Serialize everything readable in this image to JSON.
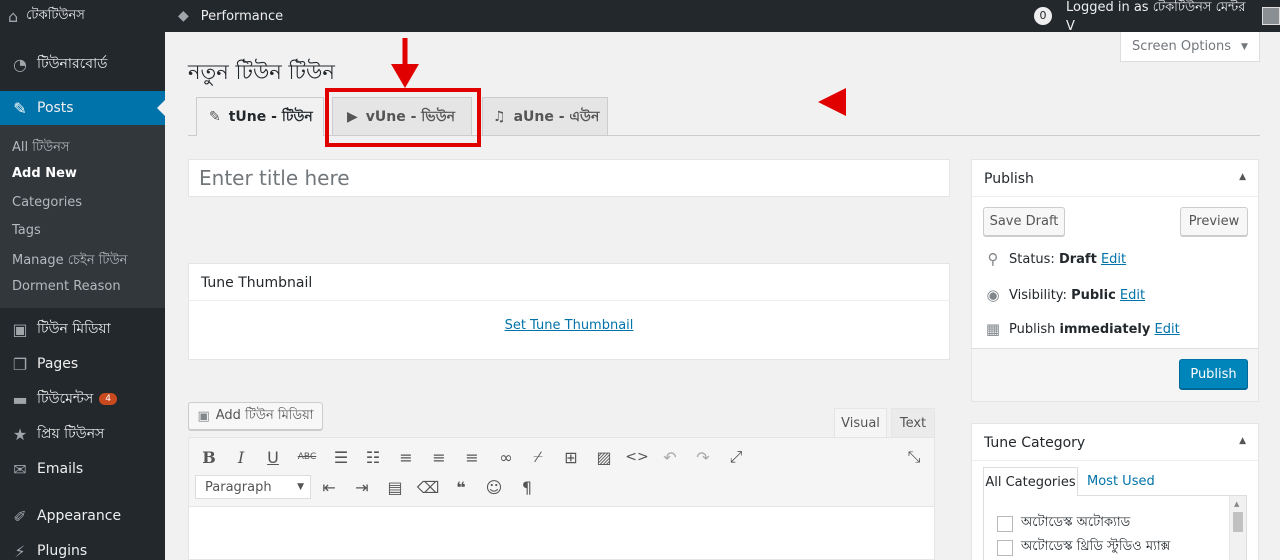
{
  "admin_bar": {
    "site_name": "টেকটিউনস",
    "performance": "Performance",
    "comments_count": "0",
    "logged_in": "Logged in as টেকটিউনস মেন্টর V"
  },
  "sidebar": {
    "dashboard": "টিউনারবোর্ড",
    "posts": "Posts",
    "submenu": [
      "All টিউনস",
      "Add New",
      "Categories",
      "Tags",
      "Manage চেইন টিউন",
      "Dorment Reason"
    ],
    "media": "টিউন মিডিয়া",
    "pages": "Pages",
    "comments": "টিউমেন্টস",
    "comments_badge": "4",
    "favorites": "প্রিয় টিউনস",
    "emails": "Emails",
    "appearance": "Appearance",
    "plugins": "Plugins"
  },
  "screen_options": "Screen Options",
  "page_title": "নতুন টিউন টিউন",
  "tabs": [
    {
      "label": "tUne - টিউন",
      "icon": "pin-icon"
    },
    {
      "label": "vUne - ভিউন",
      "icon": "video-icon"
    },
    {
      "label": "aUne - এউন",
      "icon": "music-icon"
    }
  ],
  "title_placeholder": "Enter title here",
  "thumbnail": {
    "heading": "Tune Thumbnail",
    "link": "Set Tune Thumbnail"
  },
  "editor": {
    "add_media": "Add টিউন মিডিয়া",
    "visual_tab": "Visual",
    "text_tab": "Text",
    "format_select": "Paragraph"
  },
  "publish": {
    "heading": "Publish",
    "save_draft": "Save Draft",
    "preview": "Preview",
    "status_label": "Status:",
    "status_value": "Draft",
    "visibility_label": "Visibility:",
    "visibility_value": "Public",
    "publish_label": "Publish",
    "publish_value": "immediately",
    "edit": "Edit",
    "publish_button": "Publish"
  },
  "tune_category": {
    "heading": "Tune Category",
    "tab_all": "All Categories",
    "tab_used": "Most Used",
    "items": [
      "অটোডেস্ক অটোক্যাড",
      "অটোডেস্ক থ্রিডি স্টুডিও ম্যাক্স"
    ]
  },
  "colors": {
    "admin_bg": "#23282d",
    "accent": "#0073aa",
    "annotation_red": "#e00000"
  }
}
